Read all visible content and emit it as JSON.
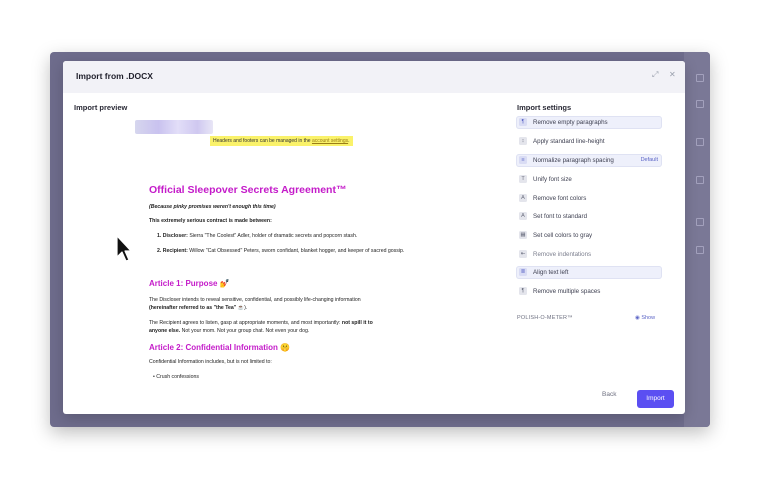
{
  "dialog": {
    "title": "Import from .DOCX",
    "expand_icon": "expand-icon",
    "close_icon": "close-icon",
    "back_label": "Back",
    "import_label": "Import"
  },
  "preview": {
    "label": "Import preview",
    "header_note": "Headers and footers can be managed in the ",
    "header_note_link": "account settings",
    "header_note_end": ".",
    "doc": {
      "title": "Official Sleepover Secrets Agreement™",
      "subtitle": "(Because pinky promises weren't enough this time)",
      "intro": "This extremely serious contract is made between:",
      "parties": [
        {
          "num": "1.",
          "role": "Discloser:",
          "text": " Sierra \"The Coolest\" Adler, holder of dramatic secrets and popcorn stash."
        },
        {
          "num": "2.",
          "role": "Recipient:",
          "text": " Willow \"Cat Obsessed\" Peters, sworn confidant, blanket hogger, and keeper of sacred gossip."
        }
      ],
      "article1_title": "Article 1: Purpose 💅",
      "article1_p1a": "The Discloser intends to reveal sensitive, confidential, and possibly life-changing information",
      "article1_p1b_bold": "(hereinafter referred to as \"the Tea\" ",
      "article1_p1b_end": "☕).",
      "article1_p2a": "The Recipient agrees to listen, gasp at appropriate moments, and most importantly: ",
      "article1_p2a_bold": "not spill it to",
      "article1_p2b_bold": "anyone else.",
      "article1_p2b": " Not your mom. Not your group chat. Not even your dog.",
      "article2_title": "Article 2: Confidential Information 🤫",
      "article2_p1": "Confidential Information includes, but is not limited to:",
      "article2_bullet1": "Crush confessions"
    }
  },
  "settings": {
    "label": "Import settings",
    "items": [
      {
        "label": "Remove empty paragraphs",
        "icon": "paragraph-icon",
        "glyph": "¶",
        "highlighted": true,
        "muted": false
      },
      {
        "label": "Apply standard line-height",
        "icon": "line-height-icon",
        "glyph": "↕",
        "highlighted": false,
        "muted": false
      },
      {
        "label": "Normalize paragraph spacing",
        "icon": "spacing-icon",
        "glyph": "≡",
        "highlighted": true,
        "muted": false,
        "badge": "Default"
      },
      {
        "label": "Unify font size",
        "icon": "font-size-icon",
        "glyph": "T",
        "highlighted": false,
        "muted": false
      },
      {
        "label": "Remove font colors",
        "icon": "font-color-icon",
        "glyph": "A",
        "highlighted": false,
        "muted": false
      },
      {
        "label": "Set font to standard",
        "icon": "font-icon",
        "glyph": "A",
        "highlighted": false,
        "muted": false
      },
      {
        "label": "Set cell colors to gray",
        "icon": "table-icon",
        "glyph": "▦",
        "highlighted": false,
        "muted": false
      },
      {
        "label": "Remove indentations",
        "icon": "indent-icon",
        "glyph": "⇤",
        "highlighted": false,
        "muted": true
      },
      {
        "label": "Align text left",
        "icon": "align-left-icon",
        "glyph": "≣",
        "highlighted": true,
        "muted": false
      },
      {
        "label": "Remove multiple spaces",
        "icon": "spaces-icon",
        "glyph": "¶",
        "highlighted": false,
        "muted": false
      }
    ],
    "meter_label": "POLISH-O-METER™",
    "show_label": "◉ Show"
  },
  "colors": {
    "accent": "#5b4ff2",
    "heading_magenta": "#c41bc9",
    "highlight": "#faf26a"
  }
}
